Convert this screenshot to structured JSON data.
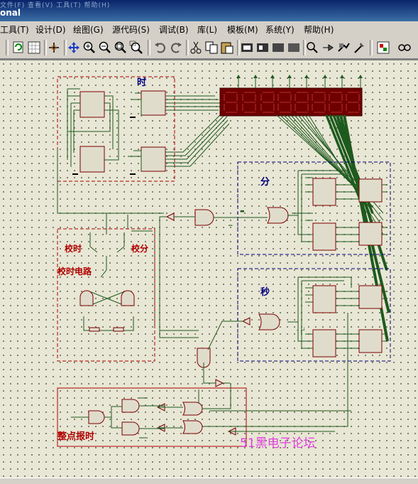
{
  "window": {
    "title": "onal",
    "ghost_menu": "文件(F)  查看(V)  工具(T)  帮助(H)"
  },
  "menubar": {
    "items": [
      "工具(T)",
      "设计(D)",
      "绘图(G)",
      "源代码(S)",
      "调试(B)",
      "库(L)",
      "模板(M)",
      "系统(Y)",
      "帮助(H)"
    ]
  },
  "toolbar": {
    "icons": [
      "refresh-icon",
      "grid-icon",
      "origin-icon",
      "pan-icon",
      "zoom-in-icon",
      "zoom-out-icon",
      "zoom-all-icon",
      "zoom-area-icon",
      "undo-icon",
      "redo-icon",
      "cut-icon",
      "copy-icon",
      "paste-icon",
      "block-copy-icon",
      "block-move-icon",
      "block-rotate-icon",
      "block-delete-icon",
      "pick-device-icon",
      "make-device-icon",
      "decompose-icon",
      "tools-icon",
      "netlist-icon",
      "search-icon"
    ]
  },
  "schematic": {
    "labels": {
      "hour": "时",
      "minute": "分",
      "second": "秒",
      "adjust_hour": "校时",
      "adjust_minute": "校分",
      "adjust_circuit": "校时电路",
      "hourly_chime": "整点报时",
      "watermark": "51黑电子论坛"
    },
    "colors": {
      "component_body": "#e0dccc",
      "component_border": "#7a0000",
      "wire": "#1e5a1e",
      "box_red": "#b00000",
      "box_blue": "#000080",
      "display": "#6e0000",
      "watermark": "#e040e0"
    }
  }
}
